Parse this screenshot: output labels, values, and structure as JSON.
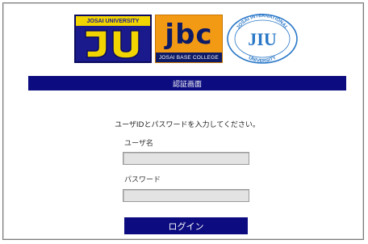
{
  "logos": {
    "ju": {
      "top_text": "JOSAI UNIVERSITY",
      "mark": "JU"
    },
    "jbc": {
      "mark": "jbc",
      "caption": "JOSAI BASE COLLEGE"
    },
    "jiu": {
      "ring_text": "JOSAI INTERNATIONAL UNIVERSITY",
      "mark": "JIU"
    }
  },
  "header": {
    "title": "認証画面"
  },
  "form": {
    "instruction": "ユーザIDとパスワードを入力してください。",
    "username_label": "ユーザ名",
    "username_value": "",
    "password_label": "パスワード",
    "password_value": "",
    "submit_label": "ログイン"
  },
  "colors": {
    "navy": "#0c0c80",
    "ju_blue": "#1a1a8c",
    "ju_yellow": "#f2d400",
    "jbc_orange": "#f39a15",
    "jiu_blue": "#2a78c8",
    "field_gray": "#e3e3e3"
  }
}
